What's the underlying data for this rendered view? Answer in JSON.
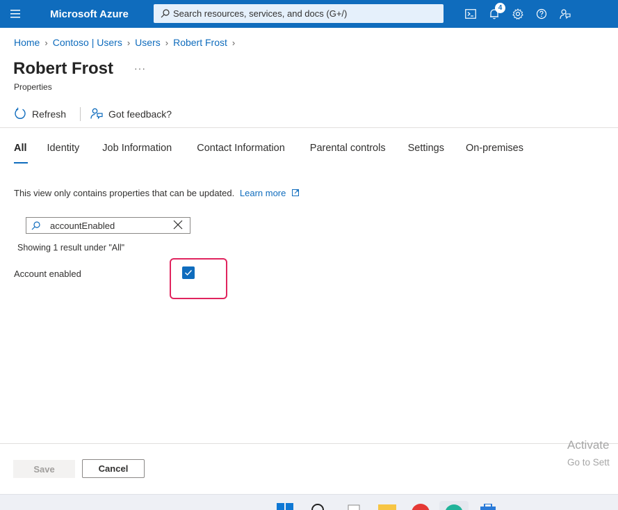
{
  "topbar": {
    "brand": "Microsoft Azure",
    "search_placeholder": "Search resources, services, and docs (G+/)",
    "notification_count": "4",
    "background": "#0f6cbd"
  },
  "breadcrumb": [
    "Home",
    "Contoso | Users",
    "Users",
    "Robert Frost"
  ],
  "page": {
    "title": "Robert Frost",
    "more": "···",
    "subtitle": "Properties"
  },
  "commands": {
    "refresh": "Refresh",
    "feedback": "Got feedback?"
  },
  "tabs": [
    "All",
    "Identity",
    "Job Information",
    "Contact Information",
    "Parental controls",
    "Settings",
    "On-premises"
  ],
  "info": {
    "text": "This view only contains properties that can be updated.",
    "link": "Learn more"
  },
  "filter": {
    "value": "accountEnabled"
  },
  "results": {
    "text": "Showing 1 result under \"All\""
  },
  "property": {
    "label": "Account enabled",
    "checked": true
  },
  "footer": {
    "save": "Save",
    "cancel": "Cancel"
  },
  "watermark": {
    "line1": "Activate",
    "line2": "Go to Sett"
  },
  "taskbar_icons": [
    "windows-start-icon",
    "search-icon",
    "file-icon",
    "folder-icon",
    "red-app-icon",
    "edge-icon",
    "store-icon"
  ]
}
